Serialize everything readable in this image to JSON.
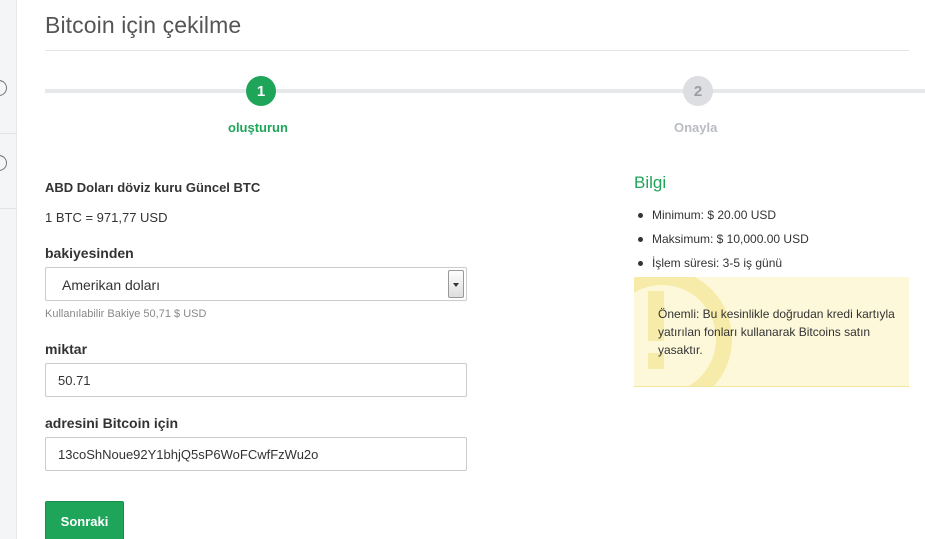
{
  "page": {
    "title": "Bitcoin için çekilme"
  },
  "stepper": {
    "steps": [
      {
        "number": "1",
        "label": "oluşturun",
        "state": "active"
      },
      {
        "number": "2",
        "label": "Onayla",
        "state": "inactive"
      }
    ],
    "active_color": "#1fa55a"
  },
  "form": {
    "rate_heading": "ABD Doları döviz kuru Güncel BTC",
    "rate_value": "1 BTC = 971,77 USD",
    "from_label": "bakiyesinden",
    "from_select_value": "Amerikan doları",
    "available_balance": "Kullanılabilir Bakiye 50,71 $ USD",
    "amount_label": "miktar",
    "amount_value": "50.71",
    "address_label": "adresini Bitcoin için",
    "address_value": "13coShNoue92Y1bhjQ5sP6WoFCwfFzWu2o",
    "submit_label": "Sonraki"
  },
  "info": {
    "title": "Bilgi",
    "items": [
      "Minimum: $ 20.00 USD",
      "Maksimum: $ 10,000.00 USD",
      "İşlem süresi: 3-5 iş günü"
    ],
    "warning": "Önemli: Bu kesinlikle doğrudan kredi kartıyla yatırılan fonları kullanarak Bitcoins satın yasaktır.",
    "warning_bg": "#fdf8d9"
  },
  "icons": {
    "rail_icons": [
      "circle-icon",
      "circle-icon"
    ],
    "select_arrow": "chevron-down-icon",
    "warning_watermark": "exclamation-icon"
  }
}
